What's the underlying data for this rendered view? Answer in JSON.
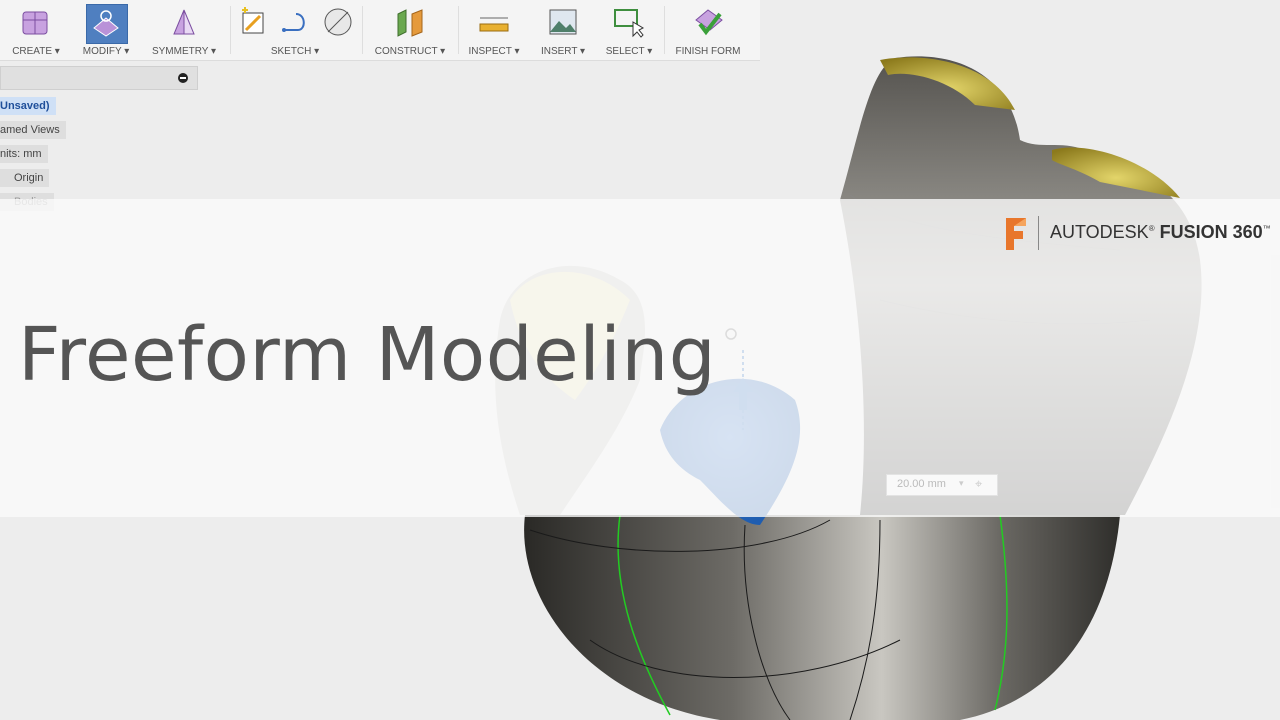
{
  "toolbar": {
    "create": "CREATE ▾",
    "modify": "MODIFY ▾",
    "symmetry": "SYMMETRY ▾",
    "sketch": "SKETCH ▾",
    "construct": "CONSTRUCT ▾",
    "inspect": "INSPECT ▾",
    "insert": "INSERT ▾",
    "select": "SELECT ▾",
    "finish_form": "FINISH FORM"
  },
  "browser": {
    "doc_name": "Unsaved)",
    "named_views": "amed Views",
    "units": "nits: mm",
    "origin": "Origin",
    "bodies": "Bodies"
  },
  "title": "Freeform Modeling",
  "brand": {
    "autodesk": "AUTODESK",
    "product": "FUSION 360"
  },
  "dimension": {
    "value": "20.00 mm"
  },
  "colors": {
    "accent_blue": "#2b6fc2",
    "brand_orange": "#e8762b",
    "edge_green": "#22cc22",
    "cap_yellow": "#c9b53c"
  }
}
